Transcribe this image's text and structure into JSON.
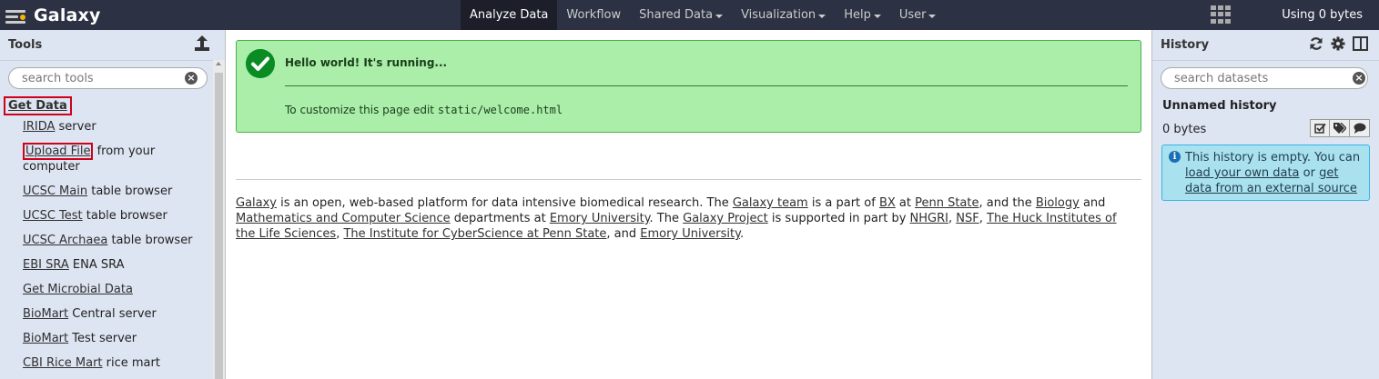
{
  "masthead": {
    "brand": "Galaxy",
    "nav": [
      {
        "label": "Analyze Data",
        "dropdown": false,
        "active": true
      },
      {
        "label": "Workflow",
        "dropdown": false,
        "active": false
      },
      {
        "label": "Shared Data",
        "dropdown": true,
        "active": false
      },
      {
        "label": "Visualization",
        "dropdown": true,
        "active": false
      },
      {
        "label": "Help",
        "dropdown": true,
        "active": false
      },
      {
        "label": "User",
        "dropdown": true,
        "active": false
      }
    ],
    "quota": "Using 0 bytes"
  },
  "tools": {
    "title": "Tools",
    "search_placeholder": "search tools",
    "section": "Get Data",
    "items": [
      {
        "link": "IRIDA",
        "rest": " server"
      },
      {
        "link": "Upload File",
        "rest": " from your computer"
      },
      {
        "link": "UCSC Main",
        "rest": " table browser"
      },
      {
        "link": "UCSC Test",
        "rest": " table browser"
      },
      {
        "link": "UCSC Archaea",
        "rest": " table browser"
      },
      {
        "link": "EBI SRA",
        "rest": " ENA SRA"
      },
      {
        "link": "Get Microbial Data",
        "rest": ""
      },
      {
        "link": "BioMart",
        "rest": " Central server"
      },
      {
        "link": "BioMart",
        "rest": " Test server"
      },
      {
        "link": "CBI Rice Mart",
        "rest": " rice mart"
      }
    ]
  },
  "welcome": {
    "alert_title": "Hello world! It's running...",
    "alert_text_prefix": "To customize this page edit ",
    "alert_text_code": "static/welcome.html",
    "about": {
      "galaxy": "Galaxy",
      "t1": " is an open, web-based platform for data intensive biomedical research. The ",
      "galaxy_team": "Galaxy team",
      "t2": " is a part of ",
      "bx": "BX",
      "t3": " at ",
      "penn_state": "Penn State",
      "t4": ", and the ",
      "biology": "Biology",
      "t5": " and ",
      "math_cs": "Mathematics and Computer Science",
      "t6": " departments at ",
      "emory": "Emory University",
      "t7": ". The ",
      "galaxy_project": "Galaxy Project",
      "t8": " is supported in part by ",
      "nhgri": "NHGRI",
      "t9": ", ",
      "nsf": "NSF",
      "t10": ", ",
      "huck": "The Huck Institutes of the Life Sciences",
      "t11": ", ",
      "ics": "The Institute for CyberScience at Penn State",
      "t12": ", and ",
      "emory2": "Emory University",
      "t13": "."
    }
  },
  "history": {
    "title": "History",
    "search_placeholder": "search datasets",
    "name": "Unnamed history",
    "size": "0 bytes",
    "empty_text": "This history is empty. You can ",
    "link_load": "load your own data",
    "or": " or ",
    "link_external": "get data from an external source"
  },
  "colors": {
    "masthead": "#2c3143",
    "panel": "#dde4f2",
    "success_bg": "#aaeeaa",
    "info_bg": "#aae1ee",
    "highlight": "#d0021b"
  }
}
